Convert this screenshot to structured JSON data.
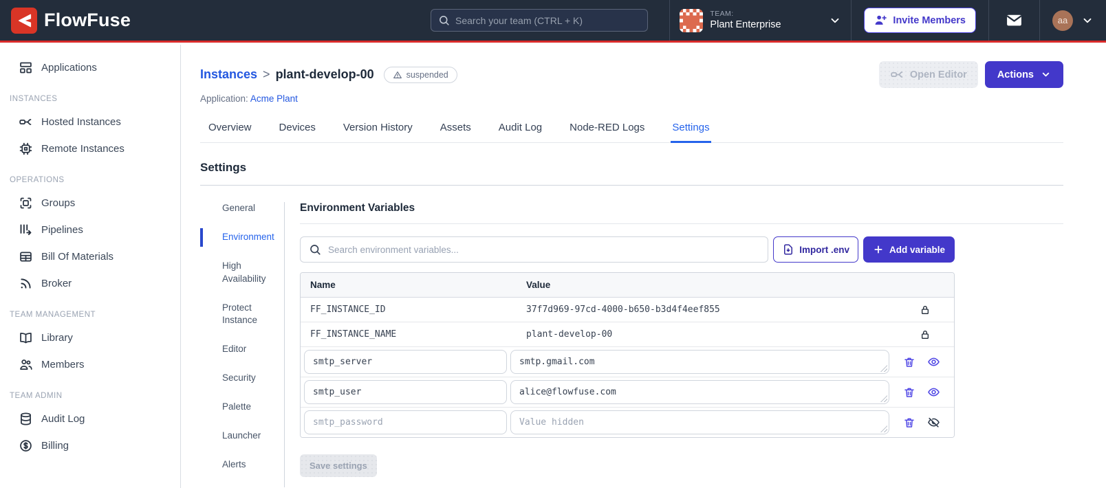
{
  "colors": {
    "navbar_bg": "#232d3b",
    "brand_red": "#d93526",
    "accent_indigo": "#4338ca",
    "link_blue": "#2357e0",
    "active_tab_blue": "#2563eb"
  },
  "navbar": {
    "brand": "FlowFuse",
    "search_placeholder": "Search your team (CTRL + K)",
    "team_label": "TEAM:",
    "team_name": "Plant Enterprise",
    "invite_button": "Invite Members",
    "avatar_initials": "aa"
  },
  "sidebar": {
    "top_item": {
      "label": "Applications"
    },
    "sections": [
      {
        "label": "INSTANCES",
        "items": [
          {
            "label": "Hosted Instances"
          },
          {
            "label": "Remote Instances"
          }
        ]
      },
      {
        "label": "OPERATIONS",
        "items": [
          {
            "label": "Groups"
          },
          {
            "label": "Pipelines"
          },
          {
            "label": "Bill Of Materials"
          },
          {
            "label": "Broker"
          }
        ]
      },
      {
        "label": "TEAM MANAGEMENT",
        "items": [
          {
            "label": "Library"
          },
          {
            "label": "Members"
          }
        ]
      },
      {
        "label": "TEAM ADMIN",
        "items": [
          {
            "label": "Audit Log"
          },
          {
            "label": "Billing"
          }
        ]
      }
    ]
  },
  "header": {
    "breadcrumb_parent": "Instances",
    "breadcrumb_separator": ">",
    "breadcrumb_current": "plant-develop-00",
    "status_badge": "suspended",
    "application_label": "Application:",
    "application_name": "Acme Plant",
    "open_editor_button": "Open Editor",
    "actions_button": "Actions"
  },
  "tabs": {
    "active": "Settings",
    "items": [
      {
        "label": "Overview"
      },
      {
        "label": "Devices"
      },
      {
        "label": "Version History"
      },
      {
        "label": "Assets"
      },
      {
        "label": "Audit Log"
      },
      {
        "label": "Node-RED Logs"
      },
      {
        "label": "Settings"
      }
    ]
  },
  "settings": {
    "title": "Settings",
    "active_nav": "Environment",
    "nav": [
      "General",
      "Environment",
      "High Availability",
      "Protect Instance",
      "Editor",
      "Security",
      "Palette",
      "Launcher",
      "Alerts"
    ],
    "section_title": "Environment Variables",
    "search_placeholder": "Search environment variables...",
    "import_button": "Import .env",
    "add_button": "Add variable",
    "save_button": "Save settings",
    "table": {
      "columns": [
        "Name",
        "Value"
      ],
      "locked_rows": [
        {
          "name": "FF_INSTANCE_ID",
          "value": "37f7d969-97cd-4000-b650-b3d4f4eef855"
        },
        {
          "name": "FF_INSTANCE_NAME",
          "value": "plant-develop-00"
        }
      ],
      "editable_rows": [
        {
          "name": "smtp_server",
          "value": "smtp.gmail.com",
          "hidden": false
        },
        {
          "name": "smtp_user",
          "value": "alice@flowfuse.com",
          "hidden": false
        },
        {
          "name": "smtp_password",
          "value": "",
          "value_placeholder": "Value hidden",
          "hidden": true
        }
      ]
    }
  }
}
